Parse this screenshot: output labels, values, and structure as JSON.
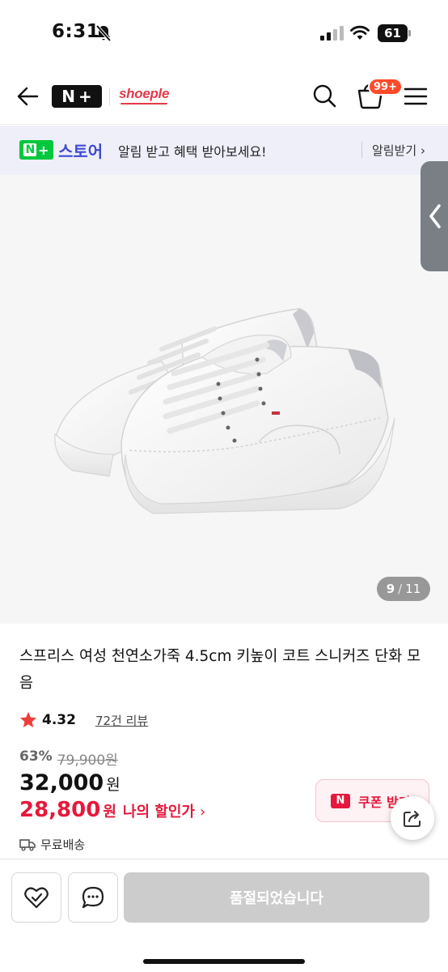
{
  "status_bar": {
    "time": "6:31",
    "battery_level": "61",
    "icons": [
      "bell-slash-icon",
      "cellular-signal-icon",
      "wifi-icon",
      "battery-icon"
    ]
  },
  "header": {
    "nplus_logo_n": "N",
    "nplus_logo_plus": "+",
    "brand_logo": "shoeple",
    "cart_badge": "99+",
    "icons": [
      "back-arrow-icon",
      "search-icon",
      "cart-icon",
      "menu-icon"
    ]
  },
  "store_banner": {
    "logo_n": "N",
    "logo_plus": "+",
    "store_name": "스토어",
    "message": "알림 받고 혜택 받아보세요!",
    "link": "알림받기 ›"
  },
  "gallery": {
    "current_page": "9",
    "separator": "/",
    "total_pages": "11"
  },
  "product": {
    "title": "스프리스 여성 천연소가죽 4.5cm 키높이 코트 스니커즈 단화 모음",
    "rating": "4.32",
    "review_count": "72건 리뷰",
    "discount_rate": "63%",
    "original_price": "79,900원",
    "sale_price": "32,000",
    "sale_price_unit": "원",
    "member_price": "28,800",
    "member_price_unit": "원",
    "member_price_label": "나의 할인가",
    "member_price_arrow": "›",
    "coupon_icon": "N",
    "coupon_label": "쿠폰 받기",
    "delivery": "무료배송"
  },
  "bottom_bar": {
    "soldout_label": "품절되었습니다"
  },
  "colors": {
    "accent_red": "#e6183c",
    "store_blue": "#3e4bd0",
    "naver_green": "#00c73c",
    "badge_orange": "#ff4b2b"
  }
}
